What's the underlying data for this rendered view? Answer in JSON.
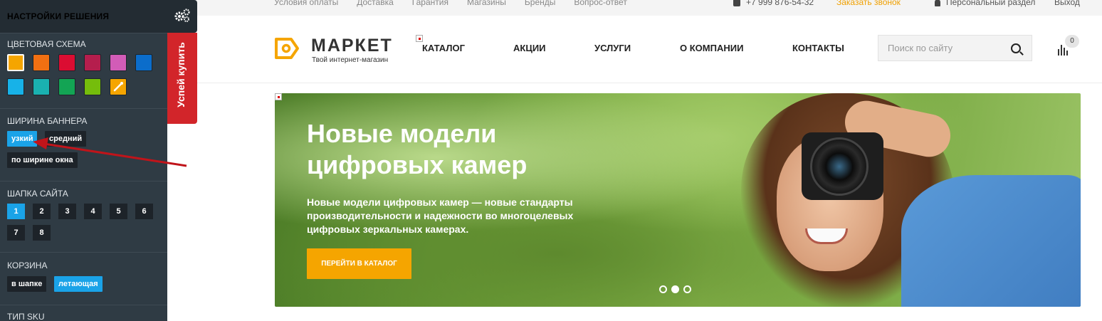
{
  "top_bar": {
    "links": [
      "Условия оплаты",
      "Доставка",
      "Гарантия",
      "Магазины",
      "Бренды",
      "Вопрос-ответ"
    ],
    "phone": "+7 999 876-54-32",
    "callback": "Заказать звонок",
    "personal": "Персональный раздел",
    "logout": "Выход"
  },
  "header": {
    "logo_title": "МАРКЕТ",
    "logo_subtitle": "Твой интернет-магазин",
    "nav": [
      "КАТАЛОГ",
      "АКЦИИ",
      "УСЛУГИ",
      "О КОМПАНИИ",
      "КОНТАКТЫ"
    ],
    "search_placeholder": "Поиск по сайту",
    "compare_count": "0"
  },
  "banner": {
    "title": "Новые модели цифровых камер",
    "text": "Новые модели цифровых камер — новые стандарты производительности и надежности во многоцелевых цифровых зеркальных камерах.",
    "button": "ПЕРЕЙТИ В КАТАЛОГ",
    "pager": {
      "count": 3,
      "active_index": 1
    }
  },
  "settings": {
    "title": "НАСТРОЙКИ РЕШЕНИЯ",
    "promo_tab": "Успей купить",
    "color_scheme": {
      "title": "ЦВЕТОВАЯ СХЕМА",
      "colors": [
        "#f5a500",
        "#f27012",
        "#db0d32",
        "#b51e4d",
        "#d25cb7",
        "#0b6dcb",
        "#17b2e8",
        "#1ab1b0",
        "#13a454",
        "#75bd0c",
        "#f5a500"
      ],
      "selected_index": 0,
      "custom_picker_icon": "eyedropper-icon"
    },
    "banner_width": {
      "title": "ШИРИНА БАННЕРА",
      "options": [
        "узкий",
        "средний",
        "по ширине окна"
      ],
      "selected": "узкий"
    },
    "site_header": {
      "title": "ШАПКА САЙТА",
      "options": [
        "1",
        "2",
        "3",
        "4",
        "5",
        "6",
        "7",
        "8"
      ],
      "selected": "1"
    },
    "basket": {
      "title": "КОРЗИНА",
      "options": [
        "в шапке",
        "летающая"
      ],
      "selected": "летающая"
    },
    "sku_type": {
      "title": "ТИП SKU"
    }
  },
  "colors": {
    "accent": "#f5a500",
    "panel_bg": "#2f3b44",
    "active_chip": "#1aa3e8",
    "promo_red": "#d2252a"
  }
}
